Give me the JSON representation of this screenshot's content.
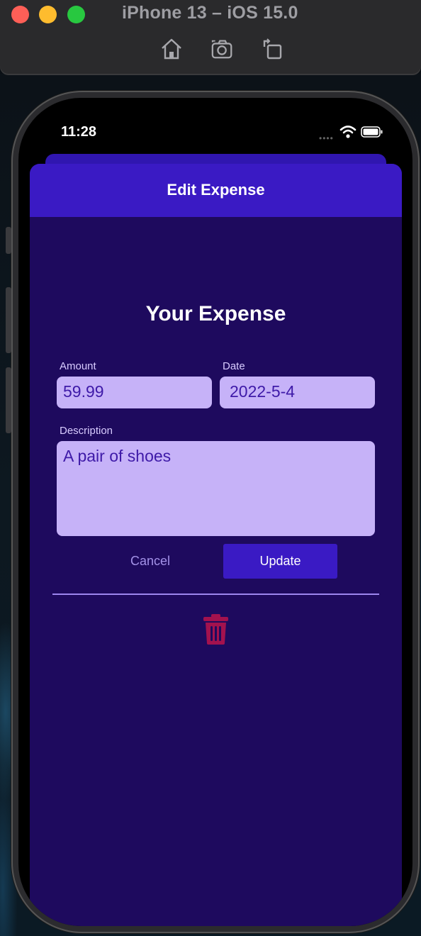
{
  "simulator": {
    "title": "iPhone 13 – iOS 15.0",
    "toolbar": [
      "home-icon",
      "screenshot-icon",
      "rotate-icon"
    ]
  },
  "status_bar": {
    "time": "11:28"
  },
  "header": {
    "title": "Edit Expense"
  },
  "form": {
    "title": "Your Expense",
    "amount": {
      "label": "Amount",
      "value": "59.99"
    },
    "date": {
      "label": "Date",
      "value": "2022-5-4"
    },
    "description": {
      "label": "Description",
      "value": "A pair of shoes"
    },
    "cancel_label": "Cancel",
    "update_label": "Update"
  },
  "colors": {
    "header_bg": "#3a1ac4",
    "sheet_bg": "#1e0a5e",
    "input_bg": "#c6b2f8",
    "input_text": "#3e1aa8",
    "delete_icon": "#a3124e"
  }
}
